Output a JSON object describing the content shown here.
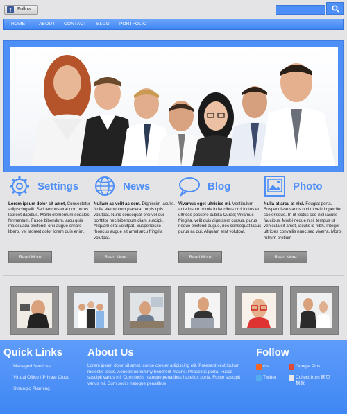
{
  "topbar": {
    "follow_label": "Follow",
    "search": {
      "placeholder": ""
    }
  },
  "nav": {
    "items": [
      {
        "label": "HOME"
      },
      {
        "label": "ABOUT"
      },
      {
        "label": "CONTACT"
      },
      {
        "label": "BLOG"
      },
      {
        "label": "PORTFOLIO"
      }
    ]
  },
  "features": [
    {
      "title": "Settings",
      "icon": "gear-icon",
      "lead": "Lorem ipsum dolor sit amet,",
      "body": " Consectetur adipiscing elit. Sed tempus erat non purus laoreet dapibus. Morbi elementum sodales fermentum. Fusce bibendum, arcu quis malesuada eleifend, orci augue ornare libero, vel laoreet dolor lorem quis enim.",
      "button": "Read More"
    },
    {
      "title": "News",
      "icon": "globe-icon",
      "lead": "Nullam ac velit ac sem.",
      "body": " Dignissim iaculis. Nulla elementum placerat turpis quis volutpat. Nunc consequat orci vel dui porttitor nec bibendum diam suscipit. Aliquam erat volutpat. Suspendisse rhoncus augue sit amet arcu fringilla volutpat.",
      "button": "Read More"
    },
    {
      "title": "Blog",
      "icon": "speech-bubble-icon",
      "lead": "Vivamus eget ultricies mi.",
      "body": " Vestibulum ante ipsum primis in faucibus orci luctus et ultrices posuere cubilia Curae; Vivamus fringilla, velit quis dignissim cursus, purus neque eleifend augue, nec consequat lacus purus ac dui. Aliquam erat volutpat.",
      "button": "Read More"
    },
    {
      "title": "Photo",
      "icon": "picture-icon",
      "lead": "Nulla at arcu at nisl.",
      "body": " Feugiat porta. Suspendisse varius orci ut velit imperdiet scelerisque. In ut lectus sed nisl iaculis faucibus. Morbi neque nisi, tempus ut vehicula sit amet, iaculis id nibh. Integer ultricies convallis nunc sed viverra. Morbi rutrum pretium",
      "button": "Read More"
    }
  ],
  "footer": {
    "quick_links": {
      "title": "Quick Links",
      "items": [
        {
          "label": "Managed Services"
        },
        {
          "label": "Virtual Office / Private Cloud"
        },
        {
          "label": "Strategic Planning"
        }
      ]
    },
    "about": {
      "title": "About Us",
      "text": "Lorem ipsum dolor sit amet, conse ctetuer adipiscing elit. Praesent vest ibulum molestie lacus. Aenean nonummy hendrerit mauris. Phasellus porta. Fusce suscipit varius mi. Cum sociis natoque penatibus hasellus porta. Fusce suscipit varius mi. Cum sociis natoque penatibus"
    },
    "follow": {
      "title": "Follow",
      "items": [
        {
          "label": "rss",
          "icon": "rss-icon",
          "color": "#f26522"
        },
        {
          "label": "Google Plus",
          "icon": "google-plus-icon",
          "color": "#dd4b39"
        },
        {
          "label": "Twitter",
          "icon": "twitter-icon",
          "color": "#55acee"
        },
        {
          "label": "Collect from 网页模板",
          "icon": "collect-icon",
          "color": "#e8e8e8"
        }
      ]
    }
  },
  "colors": {
    "accent": "#4d8ef7",
    "nav": "#4a8cf6",
    "background": "#e4e4e6",
    "button": "#8a8a8a",
    "footer": "#4f90f6"
  }
}
